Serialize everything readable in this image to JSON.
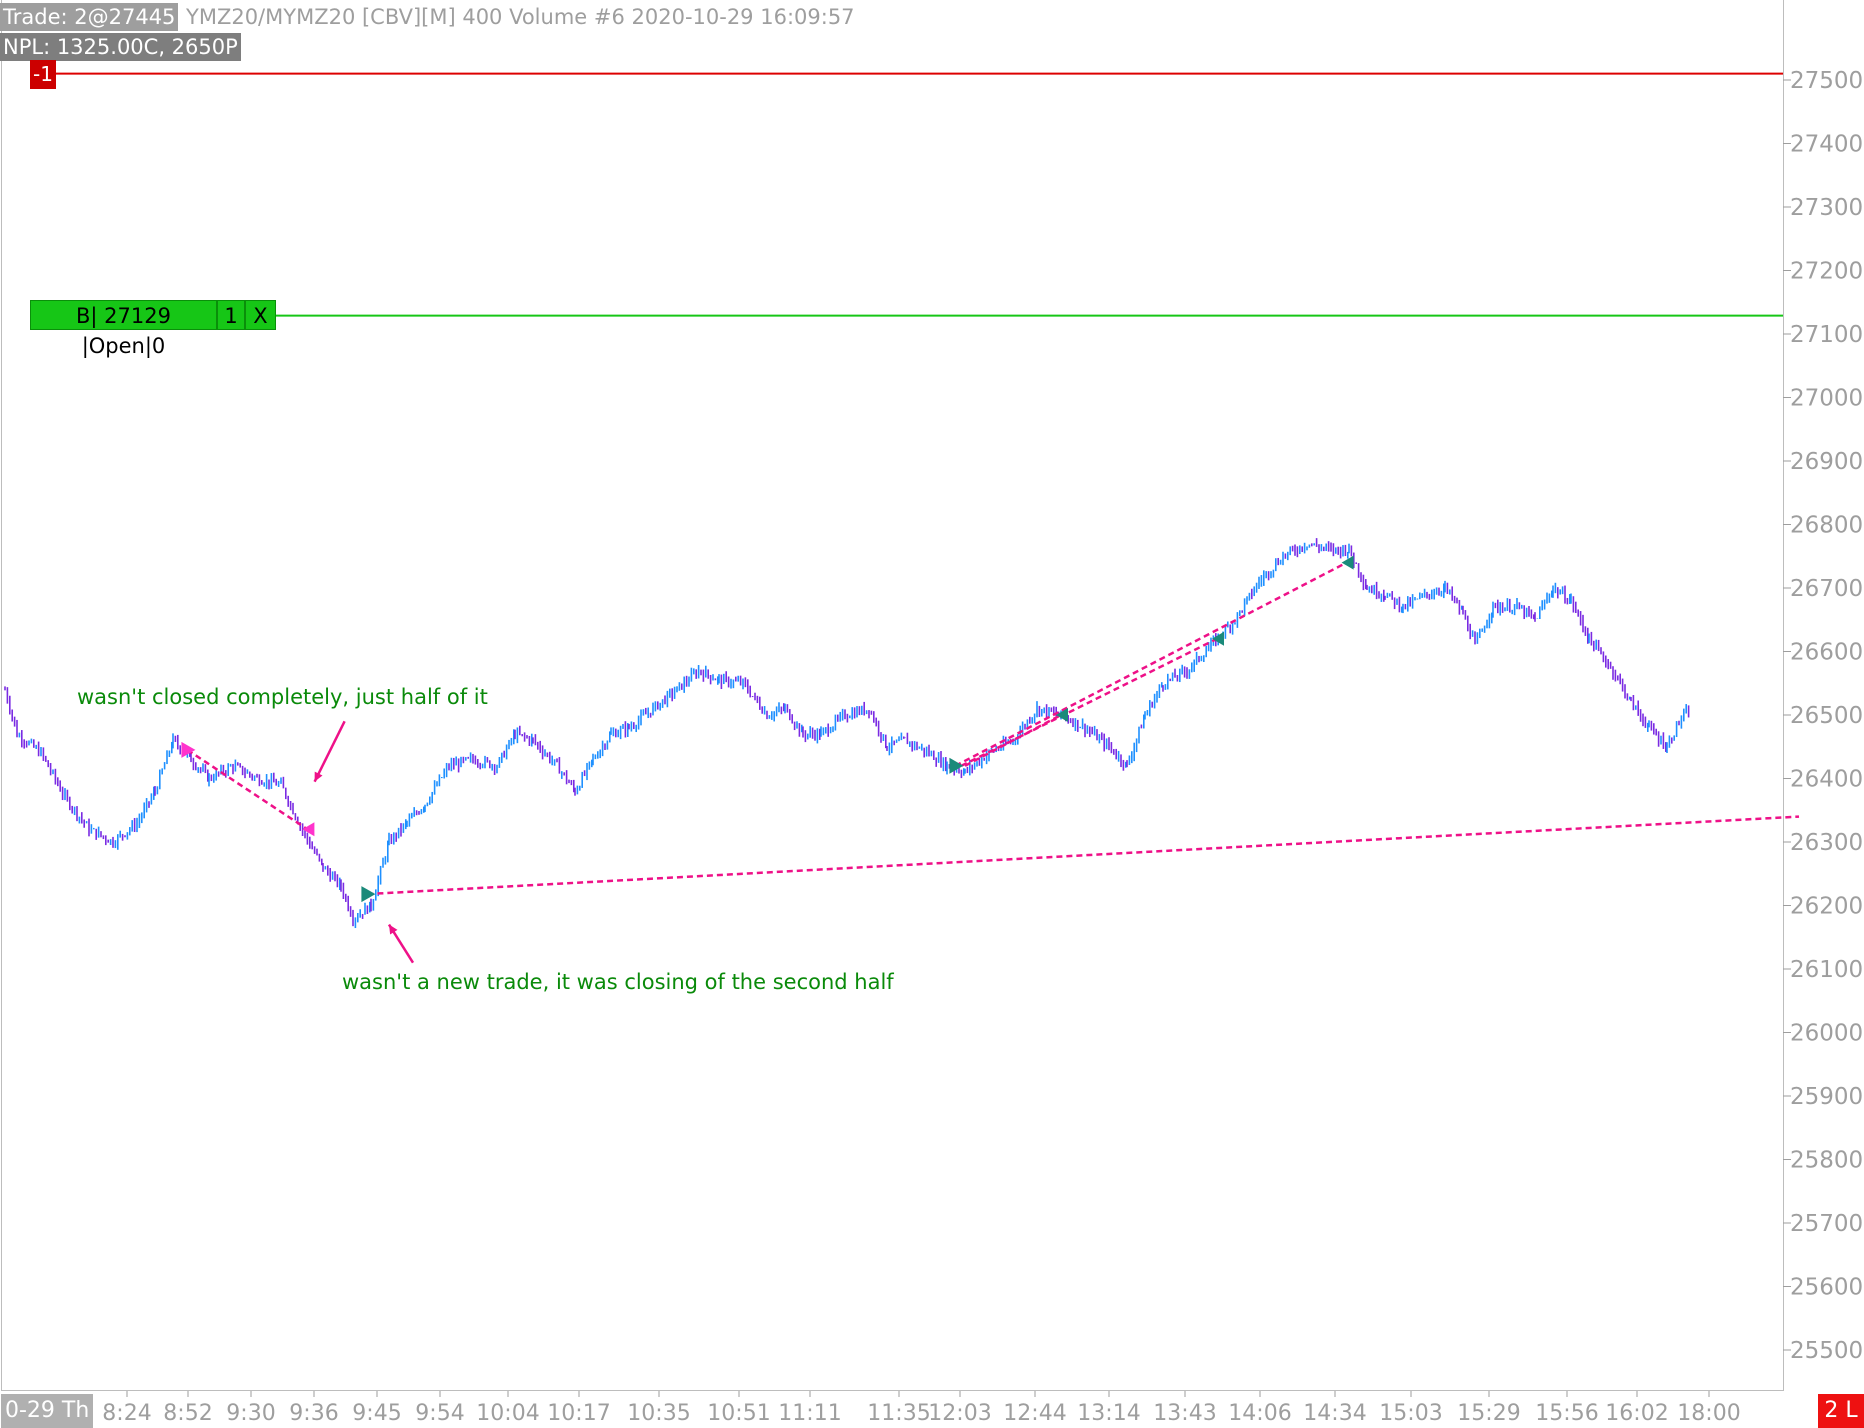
{
  "header": {
    "trade_label": "Trade: 2@27445",
    "symbol_label": "YMZ20/MYMZ20 [CBV][M]  400 Volume  #6 2020-10-29 16:09:57",
    "npl_label": "NPL: 1325.00C, 2650P"
  },
  "position_marker": {
    "label": "-1",
    "price": 27510,
    "color": "#dd0000"
  },
  "open_order": {
    "price": 27129,
    "segments": [
      "B| 27129 |Open|0",
      "1",
      "X"
    ],
    "color": "#16c616"
  },
  "annotations": [
    "wasn't closed completely, just half of it",
    "wasn't a new trade, it was closing of the second half"
  ],
  "xaxis": {
    "date_label": "0-29 Th"
  },
  "corner_badge": "2 L",
  "colors": {
    "up_bar": "#1e90ff",
    "down_bar": "#7a2be2",
    "trade_line": "#ee1188",
    "axis_text": "#9e9e9e"
  },
  "chart_data": {
    "type": "ohlc",
    "title": "",
    "xlabel": "",
    "ylabel": "",
    "ylim": [
      25450,
      27600
    ],
    "yticks": [
      27500,
      27400,
      27300,
      27200,
      27100,
      27000,
      26900,
      26800,
      26700,
      26600,
      26500,
      26400,
      26300,
      26200,
      26100,
      26000,
      25900,
      25800,
      25700,
      25600,
      25500
    ],
    "xtick_labels": [
      "8:24",
      "8:52",
      "9:30",
      "9:36",
      "9:45",
      "9:54",
      "10:04",
      "10:17",
      "10:35",
      "10:51",
      "11:11",
      "11:35",
      "12:03",
      "12:44",
      "13:14",
      "13:43",
      "14:06",
      "14:34",
      "15:03",
      "15:29",
      "15:56",
      "16:02",
      "18:00"
    ],
    "price_path": [
      [
        0,
        26540
      ],
      [
        10,
        26470
      ],
      [
        30,
        26440
      ],
      [
        50,
        26370
      ],
      [
        70,
        26320
      ],
      [
        90,
        26300
      ],
      [
        110,
        26330
      ],
      [
        125,
        26380
      ],
      [
        140,
        26460
      ],
      [
        155,
        26430
      ],
      [
        170,
        26400
      ],
      [
        190,
        26420
      ],
      [
        210,
        26400
      ],
      [
        230,
        26390
      ],
      [
        250,
        26310
      ],
      [
        265,
        26260
      ],
      [
        280,
        26230
      ],
      [
        290,
        26180
      ],
      [
        305,
        26200
      ],
      [
        320,
        26300
      ],
      [
        335,
        26330
      ],
      [
        350,
        26360
      ],
      [
        370,
        26420
      ],
      [
        390,
        26430
      ],
      [
        410,
        26420
      ],
      [
        425,
        26470
      ],
      [
        440,
        26460
      ],
      [
        460,
        26420
      ],
      [
        475,
        26380
      ],
      [
        490,
        26430
      ],
      [
        505,
        26470
      ],
      [
        520,
        26480
      ],
      [
        540,
        26510
      ],
      [
        560,
        26540
      ],
      [
        578,
        26570
      ],
      [
        595,
        26555
      ],
      [
        615,
        26550
      ],
      [
        635,
        26500
      ],
      [
        650,
        26510
      ],
      [
        665,
        26470
      ],
      [
        680,
        26470
      ],
      [
        700,
        26500
      ],
      [
        720,
        26510
      ],
      [
        735,
        26450
      ],
      [
        750,
        26460
      ],
      [
        770,
        26440
      ],
      [
        785,
        26420
      ],
      [
        800,
        26410
      ],
      [
        820,
        26440
      ],
      [
        840,
        26460
      ],
      [
        860,
        26510
      ],
      [
        880,
        26500
      ],
      [
        900,
        26480
      ],
      [
        920,
        26450
      ],
      [
        935,
        26420
      ],
      [
        950,
        26500
      ],
      [
        965,
        26550
      ],
      [
        985,
        26570
      ],
      [
        1005,
        26610
      ],
      [
        1025,
        26650
      ],
      [
        1045,
        26710
      ],
      [
        1065,
        26750
      ],
      [
        1085,
        26770
      ],
      [
        1105,
        26760
      ],
      [
        1120,
        26760
      ],
      [
        1135,
        26700
      ],
      [
        1150,
        26690
      ],
      [
        1165,
        26670
      ],
      [
        1185,
        26690
      ],
      [
        1200,
        26700
      ],
      [
        1215,
        26660
      ],
      [
        1225,
        26610
      ],
      [
        1240,
        26670
      ],
      [
        1260,
        26670
      ],
      [
        1275,
        26650
      ],
      [
        1290,
        26700
      ],
      [
        1305,
        26680
      ],
      [
        1320,
        26620
      ],
      [
        1340,
        26570
      ],
      [
        1355,
        26520
      ],
      [
        1370,
        26480
      ],
      [
        1385,
        26450
      ],
      [
        1395,
        26490
      ],
      [
        1405,
        26510
      ]
    ],
    "trades": [
      {
        "from_bar": 152,
        "from_price": 26445,
        "to_bar": 252,
        "to_price": 26320
      },
      {
        "from_bar": 302,
        "from_price": 26218,
        "to_bar": 1495,
        "to_price": 26340
      },
      {
        "from_bar": 792,
        "from_price": 26420,
        "to_bar": 1118,
        "to_price": 26740
      },
      {
        "from_bar": 797,
        "from_price": 26420,
        "to_bar": 1010,
        "to_price": 26620
      },
      {
        "from_bar": 800,
        "from_price": 26420,
        "to_bar": 880,
        "to_price": 26500
      }
    ],
    "trade_markers": [
      {
        "bar": 152,
        "price": 26445,
        "kind": "entry-magenta"
      },
      {
        "bar": 252,
        "price": 26320,
        "kind": "exit-magenta"
      },
      {
        "bar": 302,
        "price": 26218,
        "kind": "entry-teal"
      },
      {
        "bar": 792,
        "price": 26420,
        "kind": "entry-teal"
      },
      {
        "bar": 880,
        "price": 26500,
        "kind": "exit-teal"
      },
      {
        "bar": 1010,
        "price": 26620,
        "kind": "exit-teal"
      },
      {
        "bar": 1118,
        "price": 26740,
        "kind": "exit-teal"
      }
    ],
    "arrows": [
      {
        "bar1": 283,
        "price1": 26490,
        "bar2": 258,
        "price2": 26395
      },
      {
        "bar1": 340,
        "price1": 26110,
        "bar2": 320,
        "price2": 26170
      }
    ]
  }
}
